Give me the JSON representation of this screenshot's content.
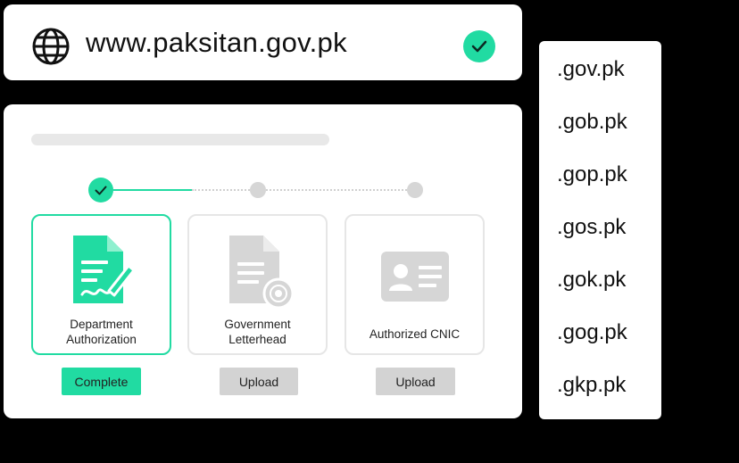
{
  "url_bar": {
    "url": "www.paksitan.gov.pk",
    "globe_icon": "globe-icon",
    "status_icon": "check-circle-icon",
    "status_color": "#21dba2"
  },
  "form": {
    "steps": [
      {
        "state": "done",
        "icon": "check-icon"
      },
      {
        "state": "pending"
      },
      {
        "state": "pending"
      }
    ],
    "documents": [
      {
        "label_line1": "Department",
        "label_line2": "Authorization",
        "icon": "signed-document-icon",
        "action": "Complete",
        "active": true
      },
      {
        "label_line1": "Government",
        "label_line2": "Letterhead",
        "icon": "letterhead-document-icon",
        "action": "Upload",
        "active": false
      },
      {
        "label_line1": "Authorized CNIC",
        "icon": "id-card-icon",
        "action": "Upload",
        "active": false
      }
    ]
  },
  "domains": [
    ".gov.pk",
    ".gob.pk",
    ".gop.pk",
    ".gos.pk",
    ".gok.pk",
    ".gog.pk",
    ".gkp.pk"
  ],
  "colors": {
    "accent": "#21dba2",
    "inactive": "#d3d3d3",
    "background": "#000000"
  }
}
